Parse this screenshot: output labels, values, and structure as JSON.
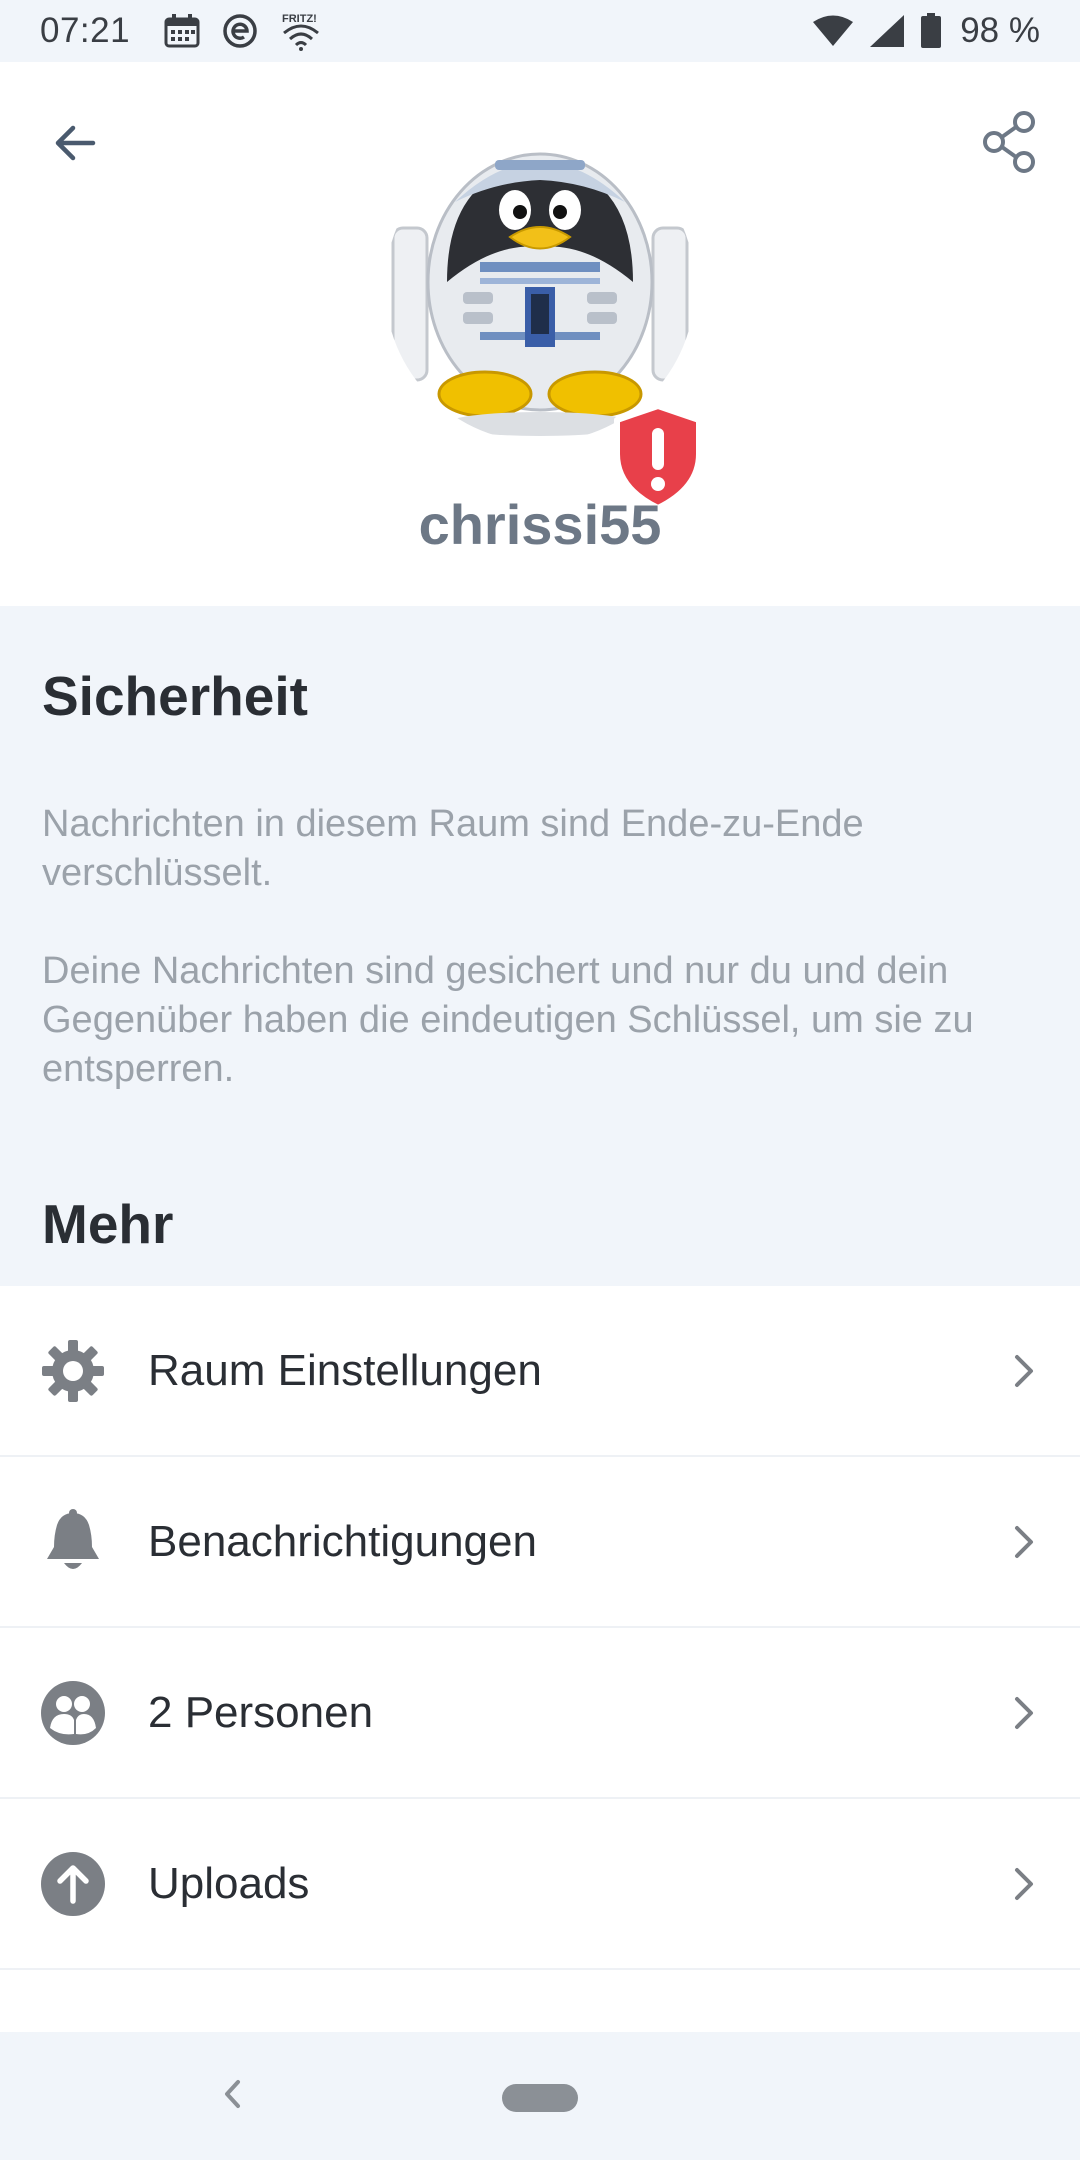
{
  "status_bar": {
    "time": "07:21",
    "battery": "98 %",
    "icons": [
      "calendar-icon",
      "e-app-icon",
      "fritz-wifi-icon",
      "wifi-icon",
      "signal-icon",
      "battery-icon"
    ]
  },
  "header": {
    "room_name": "chrissi55",
    "back_icon": "arrow-left-icon",
    "share_icon": "share-icon",
    "badge_icon": "shield-warning-icon"
  },
  "security": {
    "title": "Sicherheit",
    "text_1": "Nachrichten in diesem Raum sind Ende-zu-Ende verschlüsselt.",
    "text_2": "Deine Nachrichten sind gesichert und nur du und dein Gegenüber haben die eindeutigen Schlüssel, um sie zu entsperren."
  },
  "more": {
    "title": "Mehr",
    "items": [
      {
        "label": "Raum Einstellungen",
        "icon": "gear-icon"
      },
      {
        "label": "Benachrichtigungen",
        "icon": "bell-icon"
      },
      {
        "label": "2 Personen",
        "icon": "people-icon"
      },
      {
        "label": "Uploads",
        "icon": "upload-icon"
      }
    ]
  },
  "colors": {
    "accent_warning": "#e8404a",
    "title_text": "#2a2e34",
    "secondary_text": "#9ba2aa",
    "background": "#f1f5fa"
  }
}
